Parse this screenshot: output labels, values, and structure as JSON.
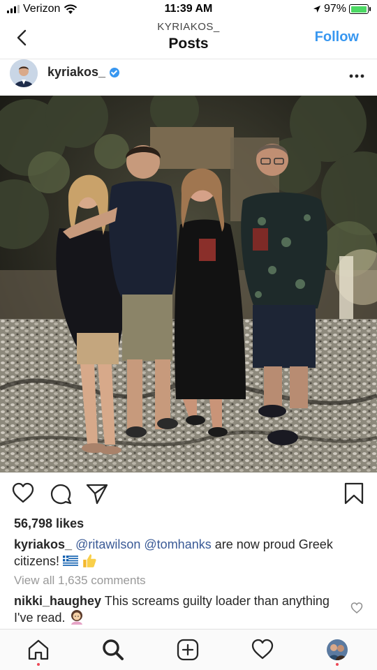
{
  "status_bar": {
    "carrier": "Verizon",
    "time": "11:39 AM",
    "battery_percent": "97%",
    "battery_level": 0.97,
    "icons": [
      "signal-icon",
      "wifi-icon",
      "location-arrow-icon",
      "battery-icon"
    ]
  },
  "header": {
    "account_name": "KYRIAKOS_",
    "title": "Posts",
    "follow_label": "Follow",
    "back_icon": "chevron-left-icon"
  },
  "post": {
    "username": "kyriakos_",
    "verified": true,
    "more_icon": "more-dots-icon",
    "image_icon": "photo",
    "likes_text": "56,798 likes",
    "caption": {
      "user": "kyriakos_",
      "mention1": "@ritawilson",
      "mention2": "@tomhanks",
      "text": " are now proud Greek citizens!",
      "emojis": [
        "greek-flag-icon",
        "thumbs-up-icon"
      ]
    },
    "view_comments": "View all 1,635 comments",
    "comment": {
      "user": "nikki_haughey",
      "text": "This screams guilty loader than anything I've read.",
      "emoji": "woman-shrugging-icon"
    }
  },
  "actions": [
    "heart-icon",
    "comment-icon",
    "share-icon",
    "bookmark-icon"
  ],
  "tabs": [
    "home-icon",
    "search-icon",
    "add-icon",
    "activity-icon",
    "profile-icon"
  ],
  "colors": {
    "accent": "#3897f0",
    "mention": "#3a5a96",
    "notification_dot": "#ed4956",
    "muted": "#999999"
  }
}
